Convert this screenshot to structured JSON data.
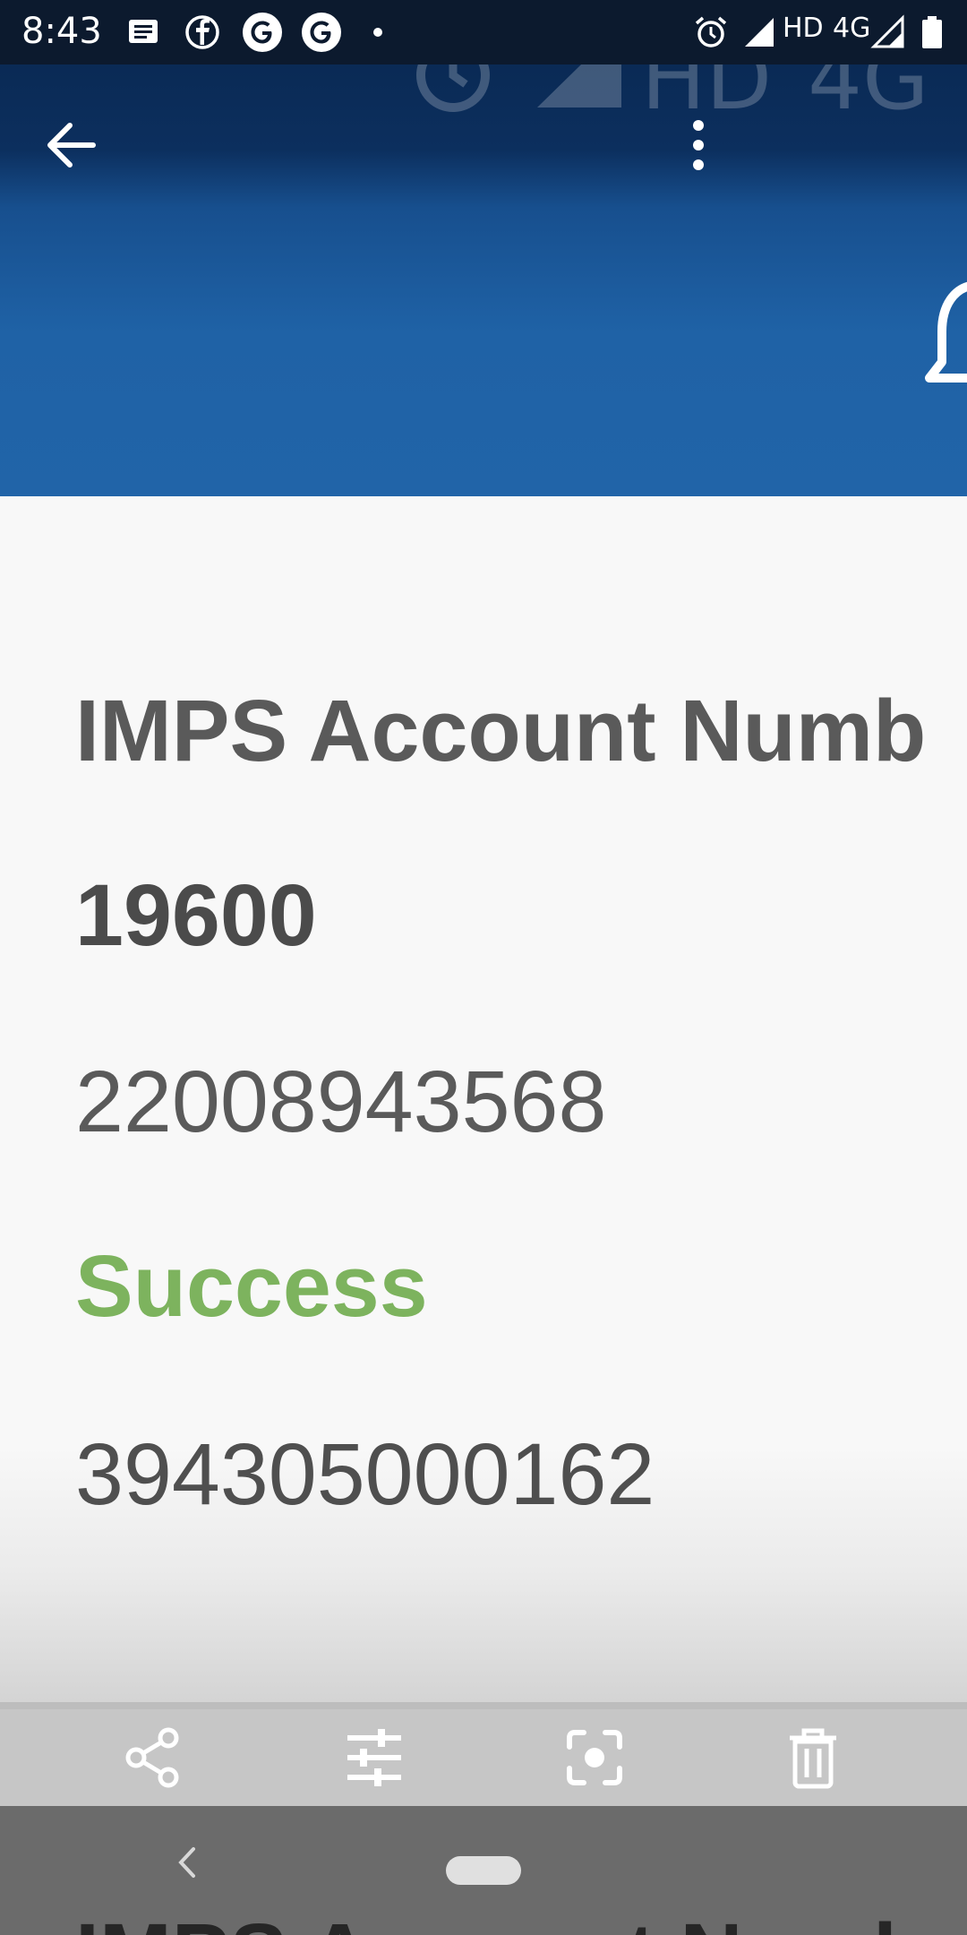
{
  "status_bar": {
    "time": "8:43",
    "left_icons": [
      "message-icon",
      "facebook-icon",
      "google-icon",
      "google-icon",
      "dot-icon"
    ],
    "right_icons": [
      "alarm-icon",
      "signal-icon",
      "hd-label",
      "4g-label",
      "signal-icon",
      "battery-icon"
    ],
    "hd": "HD",
    "network": "4G"
  },
  "app_bar": {
    "back_icon": "arrow-back-icon",
    "menu_icon": "more-vert-icon",
    "header_icon": "bell-icon",
    "ghost_hd": "HD",
    "ghost_network": "4G"
  },
  "transaction": {
    "title": "IMPS Account Numb",
    "amount": "19600",
    "account_number": "22008943568",
    "status": "Success",
    "reference_number": "394305000162"
  },
  "edit_toolbar": {
    "items": [
      "share-icon",
      "tune-icon",
      "lens-icon",
      "delete-icon"
    ]
  },
  "nav_bar": {
    "back_icon": "nav-back-icon",
    "home_icon": "home-pill-icon",
    "peek_text": "IMPS Account Numb"
  },
  "colors": {
    "header_blue": "#2164a8",
    "status_green": "#7db35e",
    "text_gray": "#5a5a5a"
  }
}
